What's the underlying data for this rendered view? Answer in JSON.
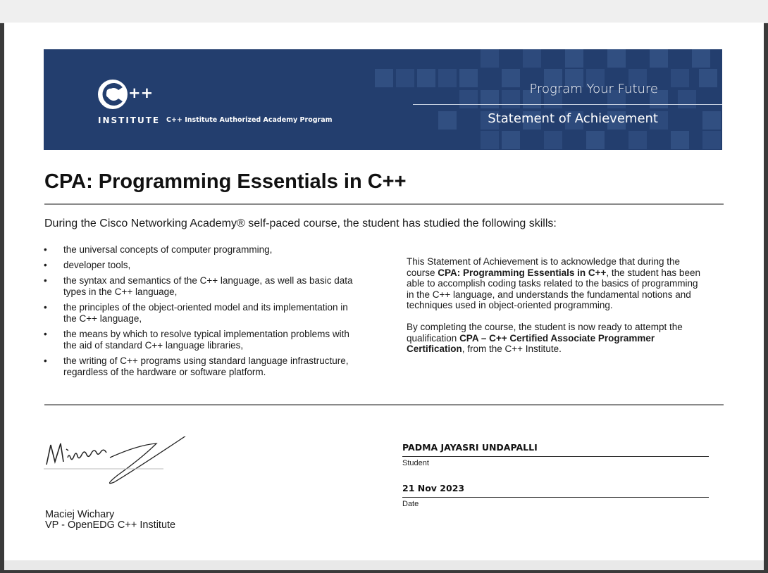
{
  "banner": {
    "logo_plus": "++",
    "logo_word": "INSTITUTE",
    "program": "C++ Institute Authorized Academy Program",
    "tagline": "Program Your Future",
    "statement": "Statement of Achievement",
    "colors": {
      "background": "#233e6e",
      "tile_light": "#3e5d92",
      "tile_mid": "#2f4d80"
    }
  },
  "course_title": "CPA: Programming Essentials in C++",
  "intro": "During the Cisco Networking Academy® self-paced course, the student has studied the following skills:",
  "skills": [
    "the universal concepts of computer programming,",
    "developer tools,",
    "the syntax and semantics of the C++ language, as well as basic data types in the C++ language,",
    "the principles of the object-oriented model and its implementation in the C++ language,",
    "the means by which to resolve typical implementation problems with the aid of standard C++ language libraries,",
    "the writing of C++ programs using standard language infrastructure, regardless of the hardware or software platform."
  ],
  "bullet": "•",
  "statement_p1": {
    "before": "This Statement of Achievement is to acknowledge that during the course ",
    "bold": "CPA: Programming Essentials in C++",
    "after": ", the student has been able to accomplish coding tasks related to the basics of programming in the C++ language, and understands the fundamental notions and techniques used in object-oriented programming."
  },
  "statement_p2": {
    "before": "By completing the course, the student is now ready to attempt the qualification ",
    "bold": "CPA – C++ Certified Associate Programmer Certification",
    "after": ", from the C++ Institute."
  },
  "signer": {
    "name": "Maciej Wichary",
    "title": "VP - OpenEDG C++ Institute"
  },
  "student": {
    "value": "PADMA JAYASRI UNDAPALLI",
    "label": "Student"
  },
  "date": {
    "value": "21 Nov 2023",
    "label": "Date"
  }
}
